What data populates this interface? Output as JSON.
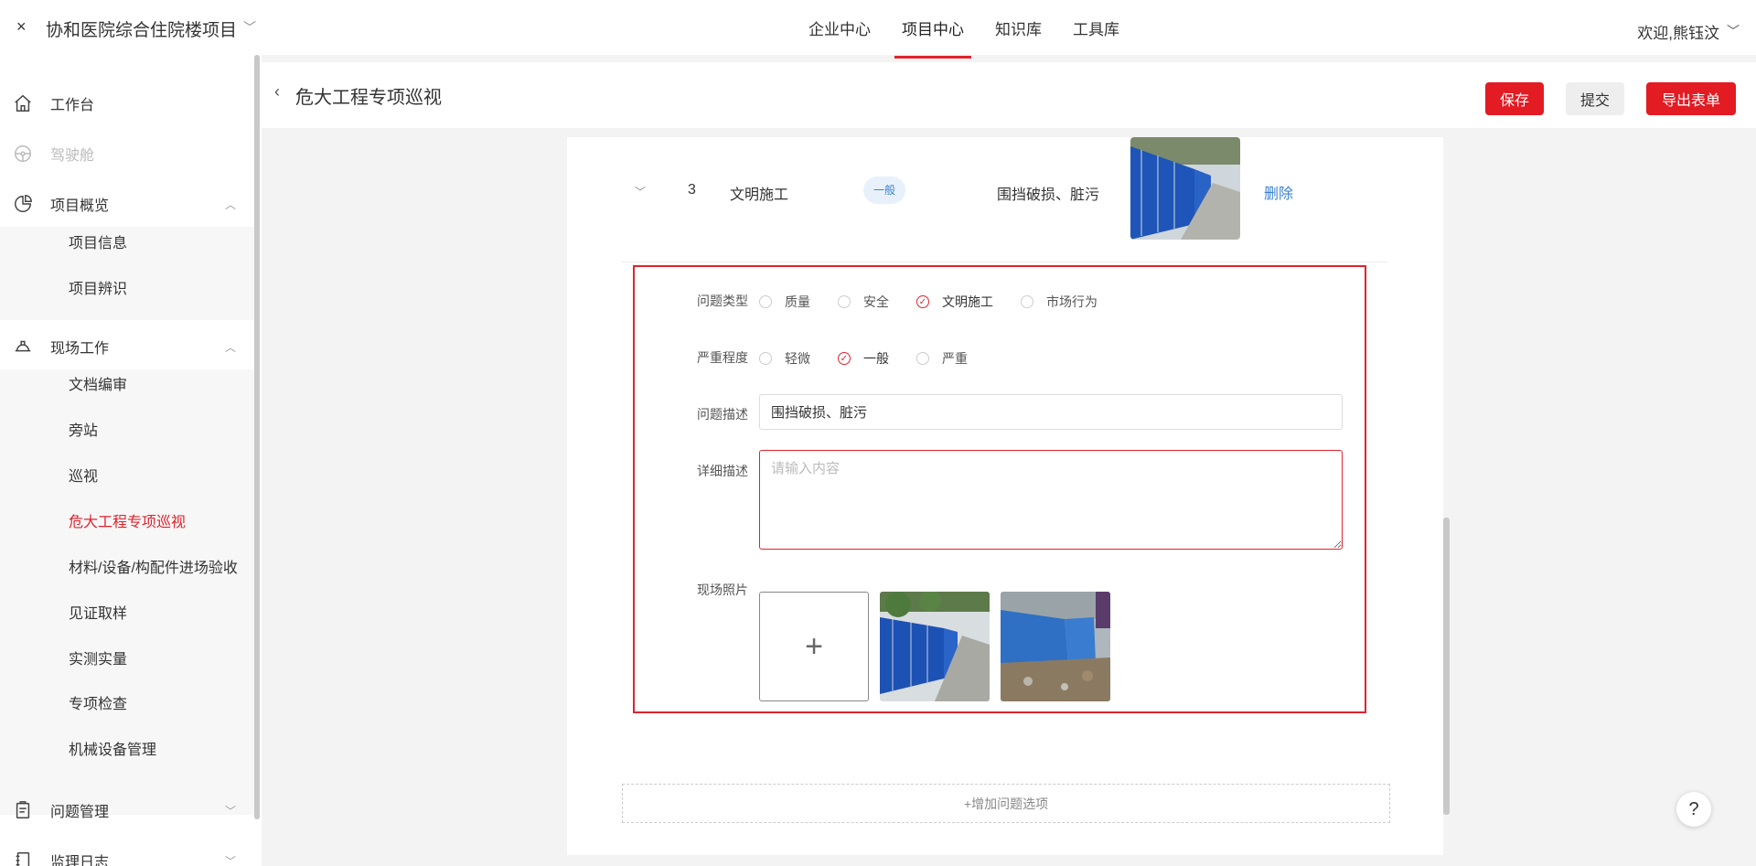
{
  "header": {
    "close_glyph": "×",
    "project_title": "协和医院综合住院楼项目",
    "nav": [
      "企业中心",
      "项目中心",
      "知识库",
      "工具库"
    ],
    "active_nav": "项目中心",
    "welcome": "欢迎,熊钰汶"
  },
  "sidebar": {
    "items": [
      {
        "label": "工作台",
        "icon": "home-icon"
      },
      {
        "label": "驾驶舱",
        "icon": "steering-icon",
        "disabled": true
      },
      {
        "label": "项目概览",
        "icon": "pie-chart-icon",
        "expanded": true
      },
      {
        "label": "现场工作",
        "icon": "helmet-icon",
        "expanded": true
      },
      {
        "label": "问题管理",
        "icon": "clipboard-icon"
      },
      {
        "label": "监理日志",
        "icon": "notebook-icon"
      }
    ],
    "overview_children": [
      "项目信息",
      "项目辨识"
    ],
    "field_children": [
      "文档编审",
      "旁站",
      "巡视",
      "危大工程专项巡视",
      "材料/设备/构配件进场验收",
      "见证取样",
      "实测实量",
      "专项检查",
      "机械设备管理"
    ],
    "active_child": "危大工程专项巡视"
  },
  "page": {
    "title": "危大工程专项巡视",
    "save_label": "保存",
    "submit_label": "提交",
    "export_label": "导出表单"
  },
  "issue_row": {
    "index": "3",
    "type": "文明施工",
    "severity_badge": "一般",
    "description": "围挡破损、脏污",
    "delete_label": "删除"
  },
  "form": {
    "type_label": "问题类型",
    "type_options": [
      "质量",
      "安全",
      "文明施工",
      "市场行为"
    ],
    "type_selected": "文明施工",
    "severity_label": "严重程度",
    "severity_options": [
      "轻微",
      "一般",
      "严重"
    ],
    "severity_selected": "一般",
    "desc_label": "问题描述",
    "desc_value": "围挡破损、脏污",
    "detail_label": "详细描述",
    "detail_placeholder": "请输入内容",
    "photos_label": "现场照片",
    "upload_glyph": "+"
  },
  "add_issue_label": "+增加问题选项",
  "help_glyph": "?",
  "colors": {
    "accent": "#e31b23",
    "link": "#3b82d6"
  }
}
